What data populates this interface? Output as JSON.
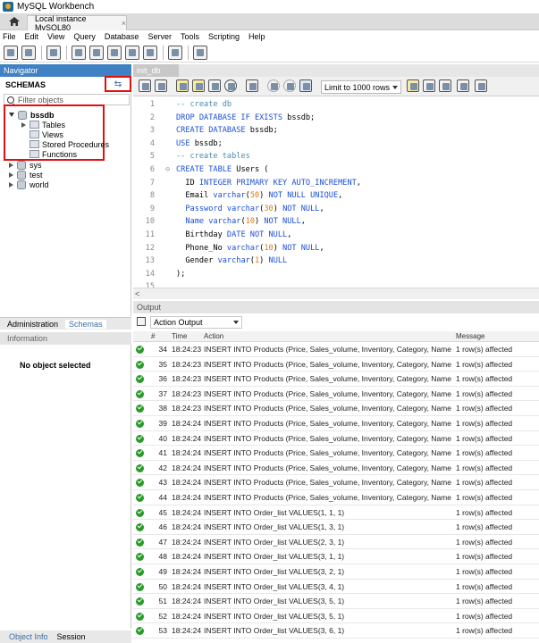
{
  "window": {
    "title": "MySQL Workbench"
  },
  "connection_tab": {
    "label": "Local instance MySQL80",
    "close": "×"
  },
  "menu": [
    "File",
    "Edit",
    "View",
    "Query",
    "Database",
    "Server",
    "Tools",
    "Scripting",
    "Help"
  ],
  "navigator": {
    "header": "Navigator",
    "schemas_label": "SCHEMAS",
    "refresh_glyph": "⇆",
    "filter_placeholder": "Filter objects",
    "tree": [
      {
        "name": "bssdb",
        "expanded": true,
        "children": [
          "Tables",
          "Views",
          "Stored Procedures",
          "Functions"
        ]
      },
      {
        "name": "sys",
        "expanded": false
      },
      {
        "name": "test",
        "expanded": false
      },
      {
        "name": "world",
        "expanded": false
      }
    ]
  },
  "left_tabs": {
    "administration": "Administration",
    "schemas": "Schemas"
  },
  "information": {
    "header": "Information",
    "empty_text": "No object selected"
  },
  "bottom_tabs": {
    "object_info": "Object Info",
    "session": "Session"
  },
  "editor": {
    "tab_label": "init_db",
    "limit_select": "Limit to 1000 rows",
    "lines": [
      {
        "n": "1",
        "html": "<span class='cm'>-- create db</span>"
      },
      {
        "n": "2",
        "html": "<span class='kw'>DROP DATABASE IF EXISTS</span> bssdb;"
      },
      {
        "n": "3",
        "html": "<span class='kw'>CREATE DATABASE</span> bssdb;"
      },
      {
        "n": "4",
        "html": "<span class='kw'>USE</span> bssdb;"
      },
      {
        "n": "5",
        "html": "<span class='cm'>-- create tables</span>"
      },
      {
        "n": "6",
        "html": "<span class='kw'>CREATE TABLE</span> Users ("
      },
      {
        "n": "7",
        "html": "  ID <span class='kw'>INTEGER PRIMARY KEY AUTO_INCREMENT</span>,"
      },
      {
        "n": "8",
        "html": "  Email <span class='kw'>varchar</span>(<span class='num'>50</span>) <span class='kw'>NOT NULL UNIQUE</span>,"
      },
      {
        "n": "9",
        "html": "  <span class='kw'>Password varchar</span>(<span class='num'>30</span>) <span class='kw'>NOT NULL</span>,"
      },
      {
        "n": "10",
        "html": "  <span class='kw'>Name varchar</span>(<span class='num'>10</span>) <span class='kw'>NOT NULL</span>,"
      },
      {
        "n": "11",
        "html": "  Birthday <span class='kw'>DATE NOT NULL</span>,"
      },
      {
        "n": "12",
        "html": "  Phone_No <span class='kw'>varchar</span>(<span class='num'>10</span>) <span class='kw'>NOT NULL</span>,"
      },
      {
        "n": "13",
        "html": "  Gender <span class='kw'>varchar</span>(<span class='num'>1</span>) <span class='kw'>NULL</span>"
      },
      {
        "n": "14",
        "html": ");"
      },
      {
        "n": "15",
        "html": ""
      }
    ]
  },
  "output": {
    "header": "Output",
    "select_label": "Action Output",
    "columns": [
      "#",
      "Time",
      "Action",
      "Message"
    ],
    "rows": [
      {
        "n": "34",
        "time": "18:24:23",
        "action": "INSERT INTO Products (Price, Sales_volume, Inventory, Category, Name, Descri...",
        "msg": "1 row(s) affected"
      },
      {
        "n": "35",
        "time": "18:24:23",
        "action": "INSERT INTO Products (Price, Sales_volume, Inventory, Category, Name, Descri...",
        "msg": "1 row(s) affected"
      },
      {
        "n": "36",
        "time": "18:24:23",
        "action": "INSERT INTO Products (Price, Sales_volume, Inventory, Category, Name, Descri...",
        "msg": "1 row(s) affected"
      },
      {
        "n": "37",
        "time": "18:24:23",
        "action": "INSERT INTO Products (Price, Sales_volume, Inventory, Category, Name, Descri...",
        "msg": "1 row(s) affected"
      },
      {
        "n": "38",
        "time": "18:24:23",
        "action": "INSERT INTO Products (Price, Sales_volume, Inventory, Category, Name, Descri...",
        "msg": "1 row(s) affected"
      },
      {
        "n": "39",
        "time": "18:24:24",
        "action": "INSERT INTO Products (Price, Sales_volume, Inventory, Category, Name, Descri...",
        "msg": "1 row(s) affected"
      },
      {
        "n": "40",
        "time": "18:24:24",
        "action": "INSERT INTO Products (Price, Sales_volume, Inventory, Category, Name, Descri...",
        "msg": "1 row(s) affected"
      },
      {
        "n": "41",
        "time": "18:24:24",
        "action": "INSERT INTO Products (Price, Sales_volume, Inventory, Category, Name, Descri...",
        "msg": "1 row(s) affected"
      },
      {
        "n": "42",
        "time": "18:24:24",
        "action": "INSERT INTO Products (Price, Sales_volume, Inventory, Category, Name, Descri...",
        "msg": "1 row(s) affected"
      },
      {
        "n": "43",
        "time": "18:24:24",
        "action": "INSERT INTO Products (Price, Sales_volume, Inventory, Category, Name, Descri...",
        "msg": "1 row(s) affected"
      },
      {
        "n": "44",
        "time": "18:24:24",
        "action": "INSERT INTO Products (Price, Sales_volume, Inventory, Category, Name, Descri...",
        "msg": "1 row(s) affected"
      },
      {
        "n": "45",
        "time": "18:24:24",
        "action": "INSERT INTO Order_list VALUES(1, 1, 1)",
        "msg": "1 row(s) affected"
      },
      {
        "n": "46",
        "time": "18:24:24",
        "action": "INSERT INTO Order_list VALUES(1, 3, 1)",
        "msg": "1 row(s) affected"
      },
      {
        "n": "47",
        "time": "18:24:24",
        "action": "INSERT INTO Order_list VALUES(2, 3, 1)",
        "msg": "1 row(s) affected"
      },
      {
        "n": "48",
        "time": "18:24:24",
        "action": "INSERT INTO Order_list VALUES(3, 1, 1)",
        "msg": "1 row(s) affected"
      },
      {
        "n": "49",
        "time": "18:24:24",
        "action": "INSERT INTO Order_list VALUES(3, 2, 1)",
        "msg": "1 row(s) affected"
      },
      {
        "n": "50",
        "time": "18:24:24",
        "action": "INSERT INTO Order_list VALUES(3, 4, 1)",
        "msg": "1 row(s) affected"
      },
      {
        "n": "51",
        "time": "18:24:24",
        "action": "INSERT INTO Order_list VALUES(3, 5, 1)",
        "msg": "1 row(s) affected"
      },
      {
        "n": "52",
        "time": "18:24:24",
        "action": "INSERT INTO Order_list VALUES(3, 5, 1)",
        "msg": "1 row(s) affected"
      },
      {
        "n": "53",
        "time": "18:24:24",
        "action": "INSERT INTO Order_list VALUES(3, 6, 1)",
        "msg": "1 row(s) affected"
      }
    ]
  },
  "colors": {
    "nav_header": "#3f81c2",
    "highlight_box": "#e01010",
    "keyword": "#1c4fd6",
    "comment": "#4a8ab0",
    "success": "#2a9a2a"
  },
  "icons": [
    "home-icon",
    "new-sql-icon",
    "open-sql-icon",
    "schema-icon",
    "table-icon",
    "refresh-icon",
    "search-icon",
    "check-icon"
  ]
}
